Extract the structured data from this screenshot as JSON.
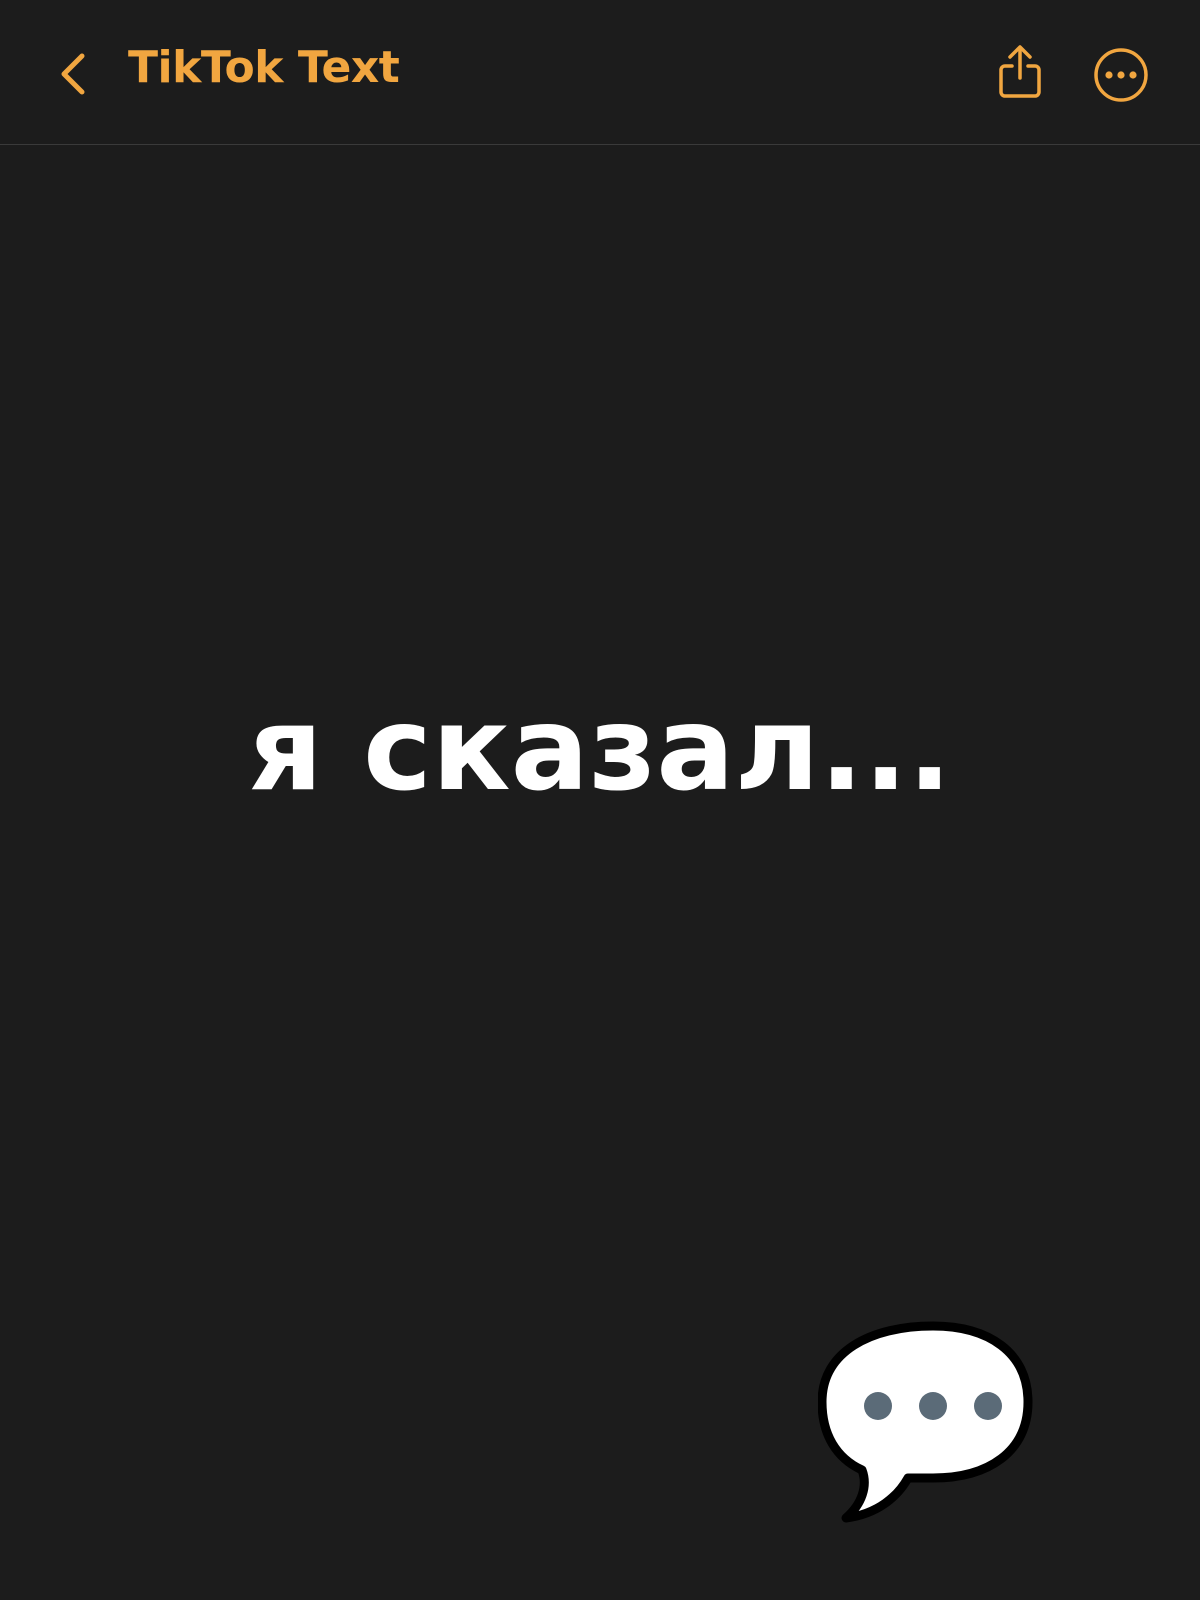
{
  "nav": {
    "title": "TikTok Text",
    "back_icon": "chevron-left-icon",
    "share_icon": "share-icon",
    "more_icon": "ellipsis-circle-icon"
  },
  "note": {
    "text": "я сказал..."
  },
  "emoji": {
    "icon": "speech-balloon-icon"
  },
  "colors": {
    "background": "#1c1c1c",
    "accent": "#f1a640",
    "text": "#ffffff",
    "divider": "#3a3a3a"
  }
}
